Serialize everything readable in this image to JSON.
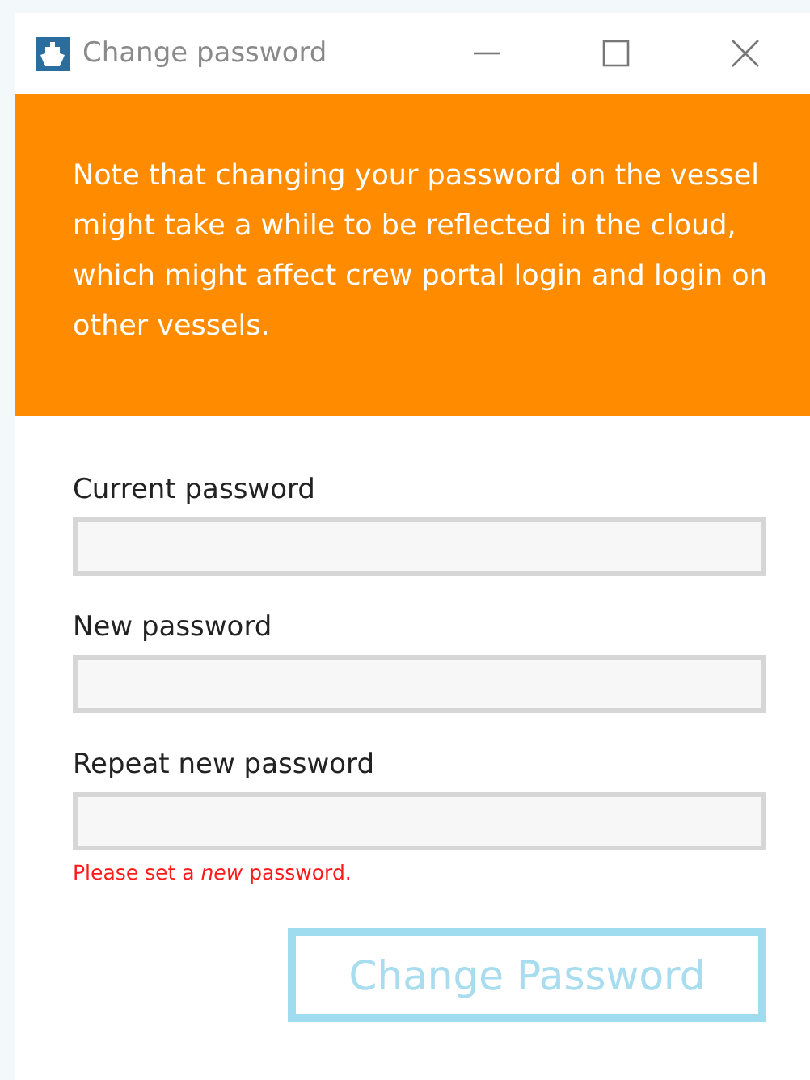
{
  "window": {
    "title": "Change password"
  },
  "notice": "Note that changing your password on the vessel might take a while to be reflected in the cloud, which might affect crew portal login and login on other vessels.",
  "fields": [
    {
      "label": "Current password"
    },
    {
      "label": "New password"
    },
    {
      "label": "Repeat new password"
    }
  ],
  "error": "Please set a *new* password.",
  "submit": {
    "label": "Change Password",
    "disabled": true
  }
}
